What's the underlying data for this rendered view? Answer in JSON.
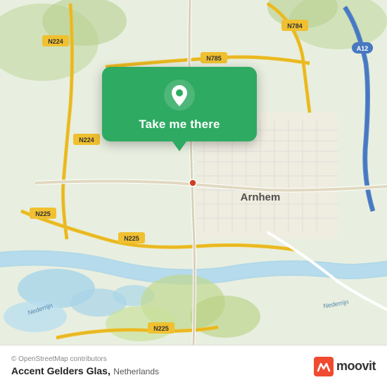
{
  "map": {
    "alt": "OpenStreetMap of Arnhem, Netherlands"
  },
  "popup": {
    "label": "Take me there",
    "pin_icon": "map-pin"
  },
  "footer": {
    "copyright": "© OpenStreetMap contributors",
    "title": "Accent Gelders Glas,",
    "subtitle": "Netherlands",
    "moovit_label": "moovit"
  },
  "road_labels": [
    "N784",
    "A12",
    "N785",
    "N224",
    "N225",
    "N224",
    "N225",
    "N225",
    "Arnhem",
    "Nederrijn",
    "Nederrijn"
  ]
}
